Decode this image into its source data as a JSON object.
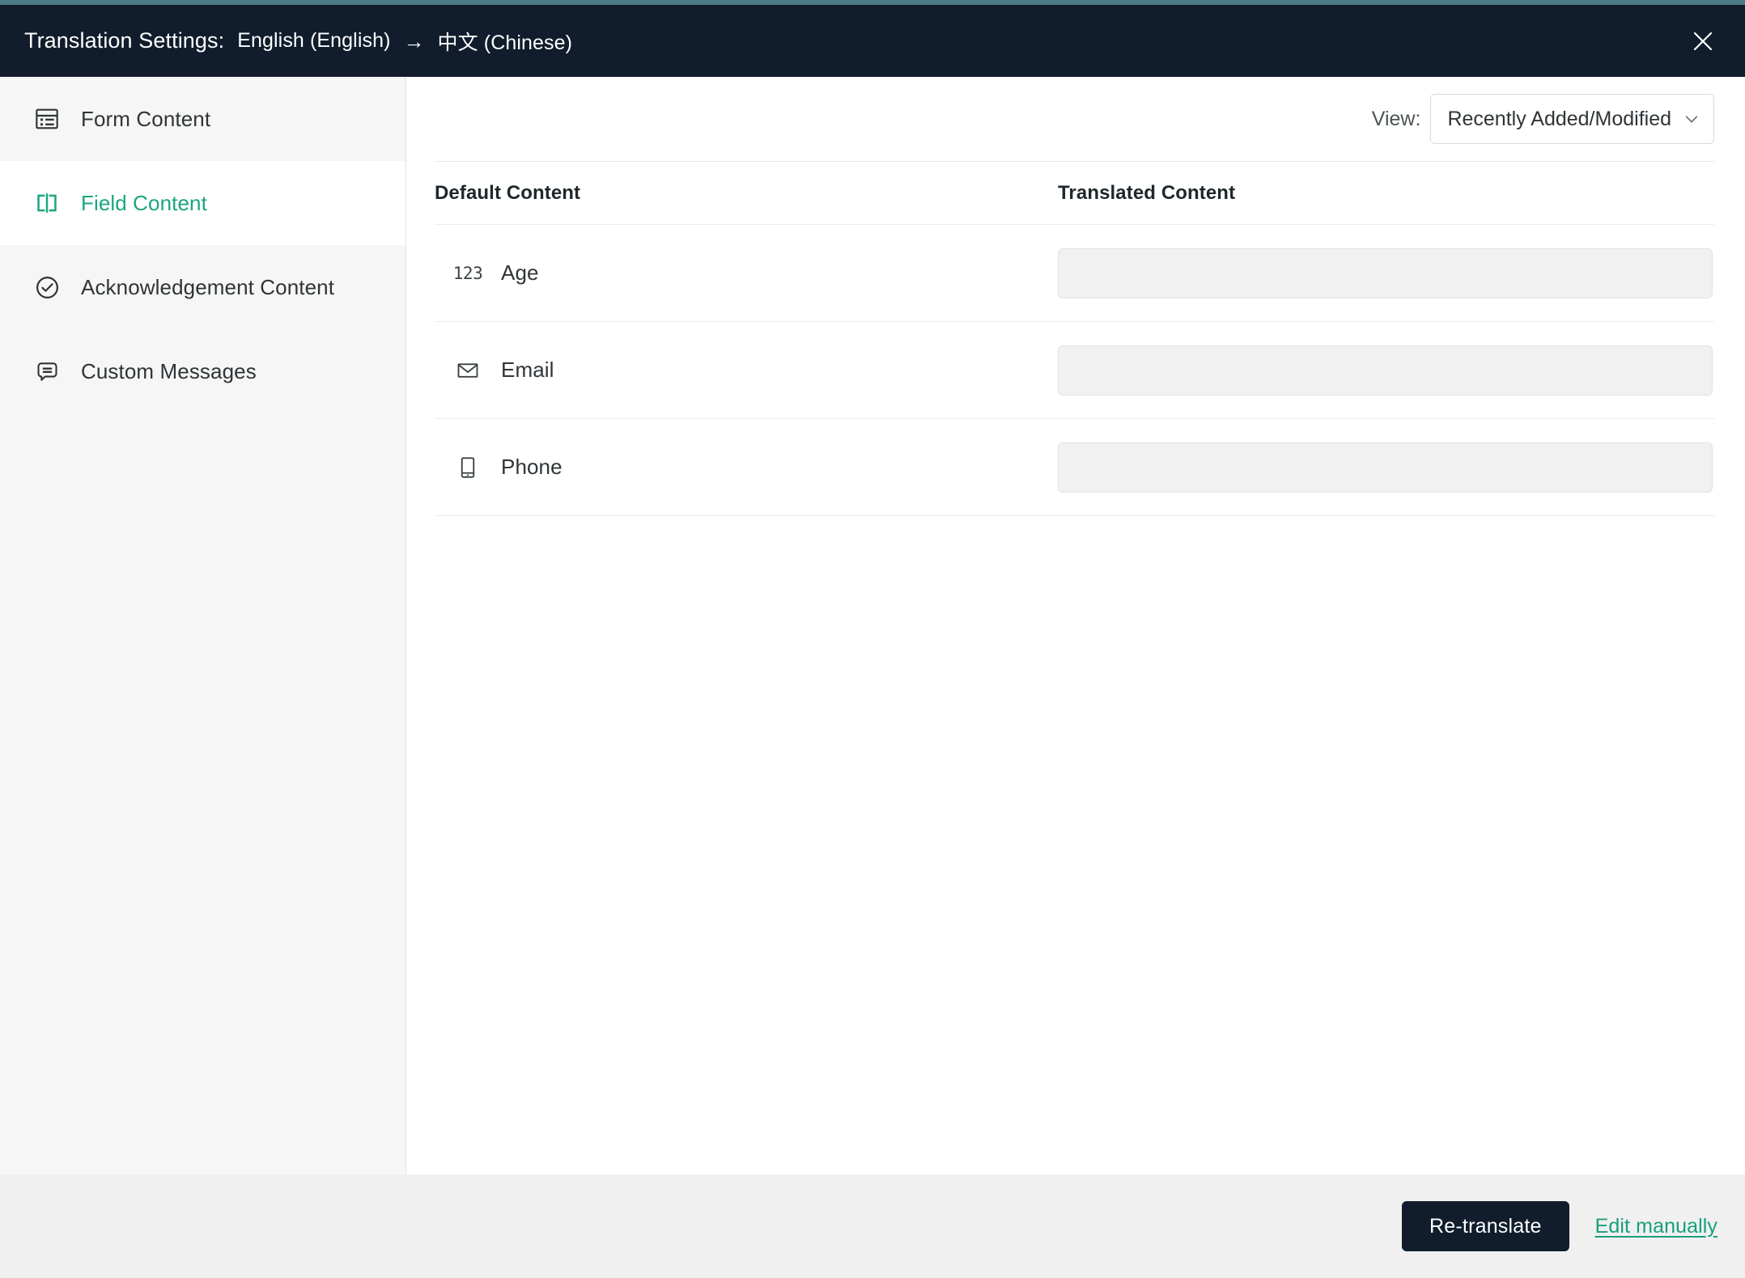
{
  "header": {
    "title": "Translation Settings:",
    "source_language": "English (English)",
    "arrow": "→",
    "target_language": "中文 (Chinese)",
    "close_icon": "close-icon"
  },
  "sidebar": {
    "items": [
      {
        "label": "Form Content",
        "icon": "form-content-icon",
        "active": false
      },
      {
        "label": "Field Content",
        "icon": "field-content-icon",
        "active": true
      },
      {
        "label": "Acknowledgement Content",
        "icon": "check-circle-icon",
        "active": false
      },
      {
        "label": "Custom Messages",
        "icon": "message-bubble-icon",
        "active": false
      }
    ]
  },
  "toolbar": {
    "view_label": "View:",
    "view_selected": "Recently Added/Modified",
    "view_options": [
      "Recently Added/Modified"
    ]
  },
  "table": {
    "columns": [
      "Default Content",
      "Translated Content"
    ],
    "rows": [
      {
        "icon": "number-123-icon",
        "label": "Age",
        "translated_value": "",
        "placeholder": ""
      },
      {
        "icon": "envelope-icon",
        "label": "Email",
        "translated_value": "",
        "placeholder": ""
      },
      {
        "icon": "mobile-phone-icon",
        "label": "Phone",
        "translated_value": "",
        "placeholder": ""
      }
    ]
  },
  "footer": {
    "retranslate_label": "Re-translate",
    "edit_manually_label": "Edit manually"
  },
  "colors": {
    "accent_strip": "#4c7b86",
    "header_bg": "#111d2c",
    "brand_teal": "#1aa67f",
    "link_teal": "#17a07c",
    "sidebar_bg": "#f6f6f6",
    "footer_bg": "#f0f0f0",
    "input_bg": "#f1f1f1",
    "text_primary": "#2f3437"
  }
}
